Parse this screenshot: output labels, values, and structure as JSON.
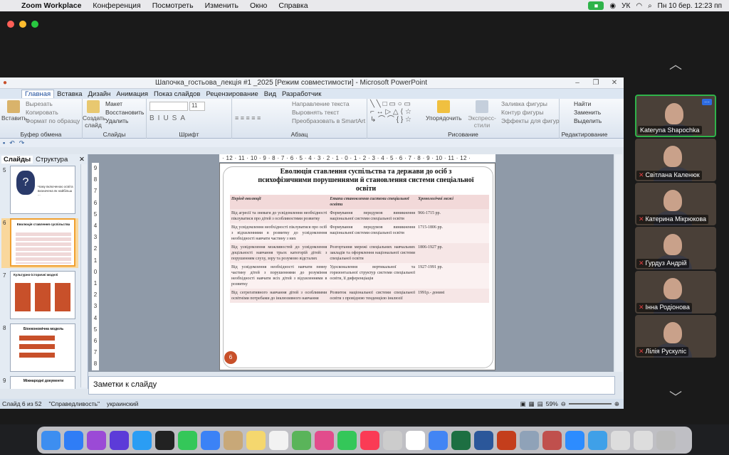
{
  "mac_menu": {
    "app": "Zoom Workplace",
    "items": [
      "Конференция",
      "Посмотреть",
      "Изменить",
      "Окно",
      "Справка"
    ],
    "clock": "Пн 10 бер.  12:23 пп",
    "lang": "УК"
  },
  "ppt": {
    "title": "Шапочка_гостьова_лекція #1 _2025 [Режим совместимости] - Microsoft PowerPoint",
    "tabs": [
      "Главная",
      "Вставка",
      "Дизайн",
      "Анимация",
      "Показ слайдов",
      "Рецензирование",
      "Вид",
      "Разработчик"
    ],
    "ribbon": {
      "paste": "Вставить",
      "cut": "Вырезать",
      "copy": "Копировать",
      "format_painter": "Формат по образцу",
      "clipboard": "Буфер обмена",
      "new_slide": "Создать слайд",
      "layout": "Макет",
      "reset": "Восстановить",
      "delete": "Удалить",
      "slides_group": "Слайды",
      "font_size": "11",
      "font_group": "Шрифт",
      "text_direction": "Направление текста",
      "align_text": "Выровнять текст",
      "smartart": "Преобразовать в SmartArt",
      "paragraph_group": "Абзац",
      "arrange": "Упорядочить",
      "quick_styles": "Экспресс-стили",
      "shape_fill": "Заливка фигуры",
      "shape_outline": "Контур фигуры",
      "shape_effects": "Эффекты для фигур",
      "drawing_group": "Рисование",
      "find": "Найти",
      "replace": "Заменить",
      "select": "Выделить",
      "editing_group": "Редактирование"
    },
    "pane_tabs": {
      "slides": "Слайды",
      "outline": "Структура"
    },
    "thumbs": [
      {
        "num": "5",
        "text": "Чому включеною освіта визначена як найбільш ..."
      },
      {
        "num": "6",
        "text": "Еволюція ставлення суспільства"
      },
      {
        "num": "7",
        "text": "Культурно-історичні моделі"
      },
      {
        "num": "8",
        "text": "Біоекономічна модель"
      },
      {
        "num": "9",
        "text": "Міжнародні документи"
      }
    ],
    "ruler_h": "· 12 · 11 · 10 · 9 · 8 · 7 · 6 · 5 · 4 · 3 · 2 · 1 · 0 · 1 · 2 · 3 · 4 · 5 · 6 · 7 · 8 · 9 · 10 · 11 · 12 ·",
    "ruler_v": [
      "9",
      "8",
      "7",
      "6",
      "5",
      "4",
      "3",
      "2",
      "1",
      "0",
      "1",
      "2",
      "3",
      "4",
      "5",
      "6",
      "7",
      "8",
      "9"
    ],
    "slide": {
      "title": "Еволюція ставлення суспільства та держави до осіб з психофізичними порушеннями й становлення системи спеціальної освіти",
      "headers": [
        "Період еволюції",
        "Етапи становлення системи спеціальної освіти",
        "Хронологічні межі"
      ],
      "rows": [
        [
          "Від агресії та зневаги до усвідомлення необхідності піклуватися про дітей з особливостями розвитку",
          "Формування передумов виникнення національної системи спеціальної освіти",
          "966-1715 рр."
        ],
        [
          "Від усвідомлення необхідності піклуватися про осіб з відхиленнями в розвитку до усвідомлення необхідності навчати частину з них",
          "Формування передумов виникнення національної системи спеціальної освіти",
          "1715-1806 рр."
        ],
        [
          "Від усвідомлення можливостей до усвідомлення доцільності навчання трьох категорій дітей: з порушенням слуху, зору та розумово відсталих",
          "Розгортання мережі спеціальних навчальних закладів та оформлення національної системи спеціальної освіти",
          "1806-1927 рр."
        ],
        [
          "Від усвідомлення необхідності навчати певну частину дітей з порушеннями до розуміння необхідності навчати всіх дітей з відхиленнями в розвитку",
          "Удосконалення вертикальної та горизонтальної структур системи спеціальної освіти, її диференціація",
          "1927-1991 рр."
        ],
        [
          "Від сегрегативного навчання дітей з особливими освітніми потребами до інклюзивного навчання",
          "Розвиток національної системи спеціальної освіти з провідною тенденцією інклюзії",
          "1991р.- донині"
        ]
      ],
      "page": "6"
    },
    "notes": "Заметки к слайду",
    "status": {
      "slide": "Слайд 6 из 52",
      "theme": "\"Справедливость\"",
      "lang": "украинский",
      "zoom": "59%"
    }
  },
  "participants": [
    "Kateryna Shapochka",
    "Світлана Каленюк",
    "Катерина Мікрюкова",
    "Гурдуз Андрій",
    "Інна Родіонова",
    "Лілія Рускуліс"
  ],
  "colors": {
    "active_speaker": "#2fb34a",
    "thumb_selected": "#f0a030",
    "page_badge": "#c8502a"
  }
}
